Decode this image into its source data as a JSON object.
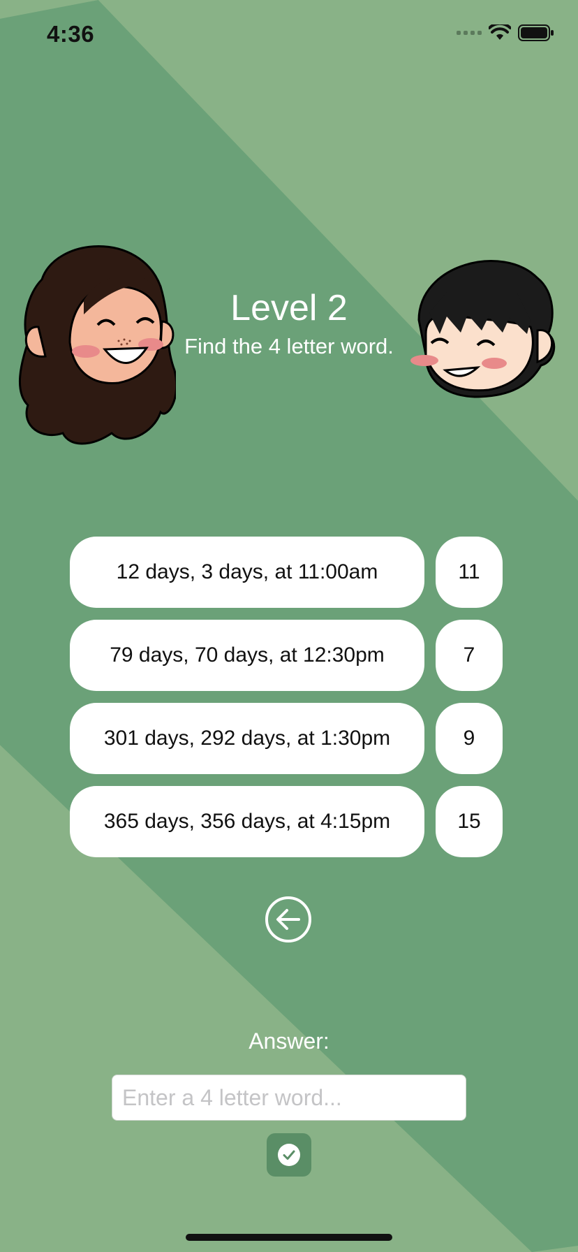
{
  "status_bar": {
    "time": "4:36",
    "icons": [
      "cellular-signal-icon",
      "wifi-icon",
      "battery-icon"
    ]
  },
  "header": {
    "title": "Level 2",
    "subtitle": "Find the 4 letter word."
  },
  "avatars": {
    "left": "girl-avatar-icon",
    "right": "boy-avatar-icon"
  },
  "clues": [
    {
      "text": "12 days, 3 days, at 11:00am",
      "number": "11"
    },
    {
      "text": "79 days, 70 days, at 12:30pm",
      "number": "7"
    },
    {
      "text": "301 days, 292 days, at 1:30pm",
      "number": "9"
    },
    {
      "text": "365 days, 356 days, at 4:15pm",
      "number": "15"
    }
  ],
  "back_button": {
    "icon": "arrow-left-circle-icon"
  },
  "answer": {
    "label": "Answer:",
    "placeholder": "Enter a 4 letter word...",
    "value": ""
  },
  "submit_button": {
    "icon": "checkmark-circle-icon"
  },
  "colors": {
    "background_light": "#89b287",
    "background_band": "#6ba178",
    "submit_bg": "#5a8e66",
    "text_light": "#ffffff"
  }
}
